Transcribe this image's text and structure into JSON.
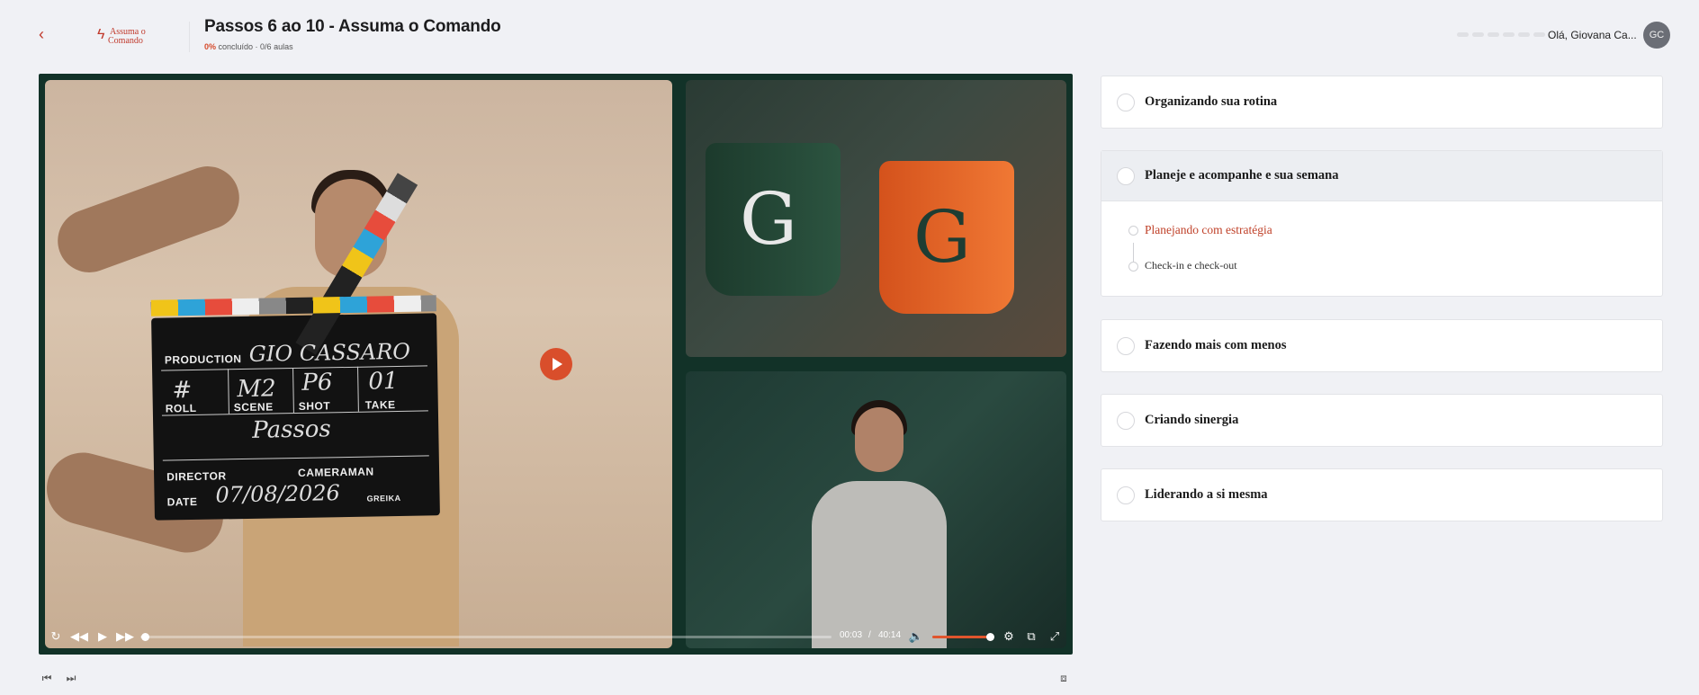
{
  "header": {
    "back_icon": "chevron-left-icon",
    "logo": {
      "line1": "Assuma o",
      "line2": "Comando"
    },
    "title": "Passos 6 ao 10 - Assuma o Comando",
    "progress_percent": "0%",
    "progress_rest": "concluído · 0/6 aulas",
    "greeting": "Olá, Giovana Ca...",
    "avatar_initials": "GC"
  },
  "player": {
    "current_time": "00:03",
    "separator": "/",
    "duration": "40:14",
    "progress": 0.001,
    "volume": 1.0,
    "clapper": {
      "production_label": "PRODUCTION",
      "production_value": "GIO CASSARO",
      "roll_label": "ROLL",
      "roll_value": "#",
      "scene_label": "SCENE",
      "scene_value": "M2",
      "shot_label": "SHOT",
      "shot_value": "P6",
      "take_label": "TAKE",
      "take_value": "01",
      "title_value": "Passos",
      "director_label": "DIRECTOR",
      "cameraman_label": "CAMERAMAN",
      "date_label": "DATE",
      "date_value": "07/08/2026",
      "brand": "GREIKA"
    },
    "mug_letter": "G",
    "controls": {
      "replay_icon": "replay-icon",
      "rewind_icon": "rewind-icon",
      "play_icon": "play-icon",
      "forward_icon": "fast-forward-icon",
      "volume_icon": "volume-icon",
      "settings_icon": "gear-icon",
      "popout_icon": "external-link-icon",
      "fullscreen_icon": "fullscreen-icon"
    }
  },
  "lessons": [
    {
      "title": "Organizando sua rotina"
    },
    {
      "title": "Planeje e acompanhe e sua semana",
      "children": [
        {
          "title": "Planejando com estratégia",
          "active": true
        },
        {
          "title": "Check-in e check-out"
        }
      ]
    },
    {
      "title": "Fazendo mais com menos"
    },
    {
      "title": "Criando sinergia"
    },
    {
      "title": "Liderando a si mesma"
    }
  ],
  "colors": {
    "accent": "#d64b2c",
    "background": "#f0f1f5",
    "player_bg": "#123228"
  }
}
